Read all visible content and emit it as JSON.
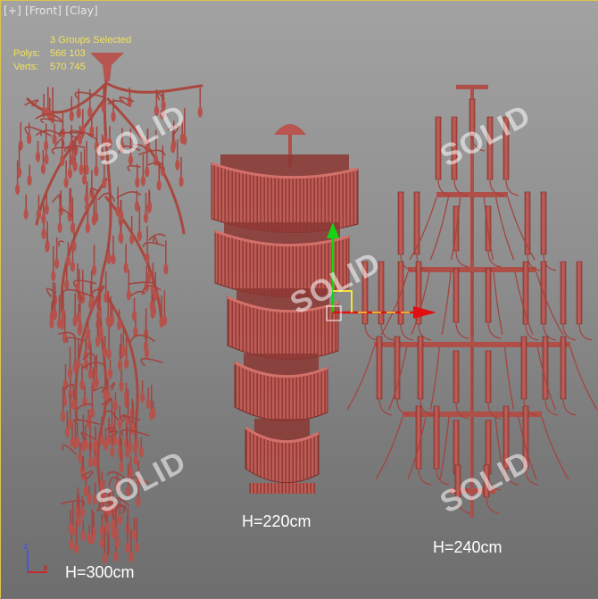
{
  "viewport": {
    "labels": [
      "[+]",
      "[Front]",
      "[Clay]"
    ]
  },
  "stats": {
    "selection": "3 Groups Selected",
    "polys_label": "Polys:",
    "polys_value": "566 103",
    "verts_label": "Verts:",
    "verts_value": "570 745"
  },
  "heights": {
    "left": "H=300cm",
    "middle": "H=220cm",
    "right": "H=240cm"
  },
  "watermark": "SOLID",
  "axis": {
    "z": "z",
    "x": "x"
  },
  "colors": {
    "clay": "#b85550",
    "clay_dark": "#8e3a36",
    "gizmo_y": "#14d414",
    "gizmo_x": "#e01010",
    "gizmo_plane": "#f2e23a"
  }
}
